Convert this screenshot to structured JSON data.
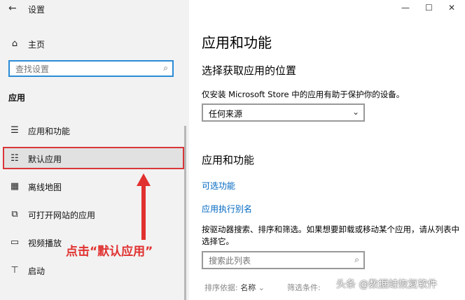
{
  "window": {
    "title": "设置",
    "back_glyph": "←",
    "minimize": "—",
    "maximize": "☐",
    "close": "✕"
  },
  "sidebar": {
    "home": "主页",
    "search_placeholder": "查找设置",
    "section": "应用",
    "items": [
      {
        "label": "应用和功能",
        "icon": "list-icon"
      },
      {
        "label": "默认应用",
        "icon": "default-apps-icon"
      },
      {
        "label": "离线地图",
        "icon": "map-icon"
      },
      {
        "label": "可打开网站的应用",
        "icon": "web-apps-icon"
      },
      {
        "label": "视频播放",
        "icon": "video-icon"
      },
      {
        "label": "启动",
        "icon": "startup-icon"
      }
    ]
  },
  "annotation": {
    "text": "点击“默认应用”",
    "color": "#e03130"
  },
  "main": {
    "title": "应用和功能",
    "section1": {
      "heading": "选择获取应用的位置",
      "description": "仅安装 Microsoft Store 中的应用有助于保护你的设备。",
      "dropdown_value": "任何来源"
    },
    "section2": {
      "heading": "应用和功能",
      "link1": "可选功能",
      "link2": "应用执行别名",
      "description": "按驱动器搜索、排序和筛选。如果想要卸载或移动某个应用，请从列表中选择它。",
      "search_placeholder": "搜索此列表",
      "sort_label": "排序依据:",
      "sort_value": "名称",
      "filter_label": "筛选条件:"
    }
  },
  "watermark": "头条 @数据蛙恢复软件",
  "colors": {
    "accent": "#2b8bd6",
    "link": "#0067c0",
    "highlight_border": "#d9363a"
  }
}
